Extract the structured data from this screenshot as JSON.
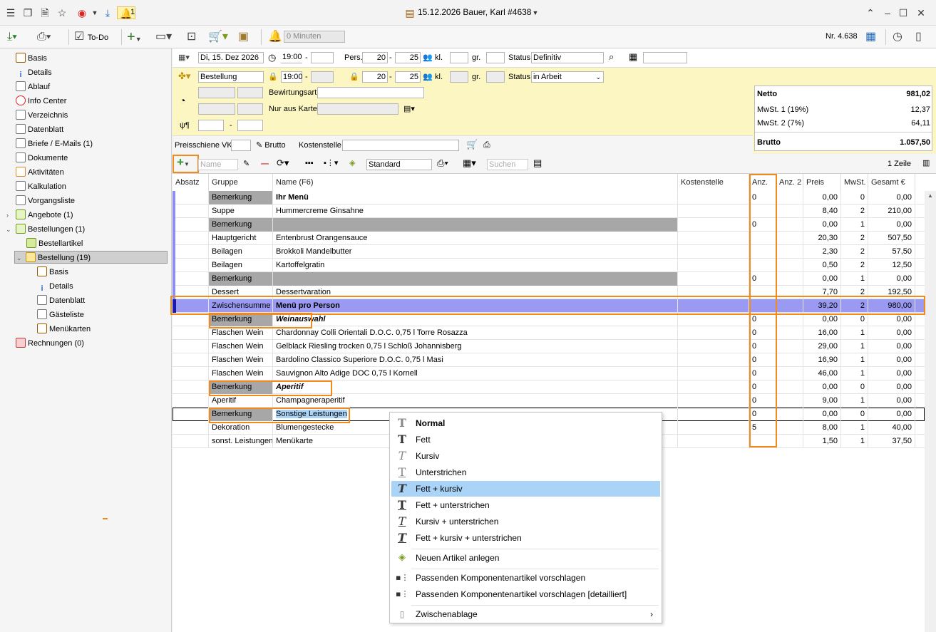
{
  "window": {
    "title": "15.12.2026 Bauer, Karl #4638",
    "notification_count": "1"
  },
  "toolbar": {
    "todo_label": "To-Do",
    "minutes_placeholder": "0 Minuten",
    "doc_number": "Nr. 4.638"
  },
  "sidebar": {
    "items": [
      {
        "label": "Basis"
      },
      {
        "label": "Details"
      },
      {
        "label": "Ablauf"
      },
      {
        "label": "Info Center"
      },
      {
        "label": "Verzeichnis"
      },
      {
        "label": "Datenblatt"
      },
      {
        "label": "Briefe / E-Mails (1)"
      },
      {
        "label": "Dokumente"
      },
      {
        "label": "Aktivitäten"
      },
      {
        "label": "Kalkulation"
      },
      {
        "label": "Vorgangsliste"
      },
      {
        "label": "Angebote (1)"
      },
      {
        "label": "Bestellungen (1)"
      },
      {
        "label": "Bestellartikel"
      },
      {
        "label": "Bestellung (19)"
      },
      {
        "label": "Basis"
      },
      {
        "label": "Details"
      },
      {
        "label": "Datenblatt"
      },
      {
        "label": "Gästeliste"
      },
      {
        "label": "Menükarten"
      },
      {
        "label": "Rechnungen (0)"
      }
    ]
  },
  "form": {
    "date": "Di, 15. Dez 2026",
    "time_from": "19:00",
    "pers_label": "Pers.",
    "pers_from": "20",
    "pers_to": "25",
    "kl_label": "kl.",
    "gr_label": "gr.",
    "status_label": "Status",
    "status_value": "Definitiv",
    "type_value": "Bestellung",
    "time2_from": "19:00",
    "pers2_from": "20",
    "pers2_to": "25",
    "status2_value": "in Arbeit",
    "bewirtung_label": "Bewirtungsart",
    "nur_aus_karte_label": "Nur aus Karte",
    "dash": "-",
    "preisschiene_label": "Preisschiene VK",
    "brutto_label": "Brutto",
    "kostenstelle_label": "Kostenstelle"
  },
  "totals": {
    "netto_label": "Netto",
    "netto_value": "981,02",
    "mwst1_label": "MwSt. 1 (19%)",
    "mwst1_value": "12,37",
    "mwst2_label": "MwSt. 2 (7%)",
    "mwst2_value": "64,11",
    "brutto_label": "Brutto",
    "brutto_value": "1.057,50"
  },
  "listbar": {
    "name_placeholder": "Name",
    "view_value": "Standard",
    "search_placeholder": "Suchen",
    "row_count": "1 Zeile"
  },
  "table": {
    "columns": [
      "Absatz",
      "Gruppe",
      "Name (F6)",
      "Kostenstelle",
      "Anz.",
      "Anz. 2",
      "Preis",
      "MwSt.",
      "Gesamt €"
    ],
    "rows": [
      {
        "gruppe": "Bemerkung",
        "name": "Ihr Menü",
        "anz": "0",
        "preis": "0,00",
        "mwst": "0",
        "gesamt": "0,00",
        "style": "bold",
        "gray": true,
        "bar": true
      },
      {
        "gruppe": "Suppe",
        "name": "Hummercreme Ginsahne",
        "anz": "",
        "preis": "8,40",
        "mwst": "2",
        "gesamt": "210,00",
        "style": "",
        "gray": false,
        "bar": true
      },
      {
        "gruppe": "Bemerkung",
        "name": "",
        "anz": "0",
        "preis": "0,00",
        "mwst": "1",
        "gesamt": "0,00",
        "style": "",
        "gray": true,
        "bar": true
      },
      {
        "gruppe": "Hauptgericht",
        "name": "Entenbrust Orangensauce",
        "anz": "",
        "preis": "20,30",
        "mwst": "2",
        "gesamt": "507,50",
        "style": "",
        "gray": false,
        "bar": true
      },
      {
        "gruppe": "Beilagen",
        "name": "Brokkoli Mandelbutter",
        "anz": "",
        "preis": "2,30",
        "mwst": "2",
        "gesamt": "57,50",
        "style": "",
        "gray": false,
        "bar": true
      },
      {
        "gruppe": "Beilagen",
        "name": "Kartoffelgratin",
        "anz": "",
        "preis": "0,50",
        "mwst": "2",
        "gesamt": "12,50",
        "style": "",
        "gray": false,
        "bar": true
      },
      {
        "gruppe": "Bemerkung",
        "name": "",
        "anz": "0",
        "preis": "0,00",
        "mwst": "1",
        "gesamt": "0,00",
        "style": "",
        "gray": true,
        "bar": true
      },
      {
        "gruppe": "Dessert",
        "name": "Dessertvaration",
        "anz": "",
        "preis": "7,70",
        "mwst": "2",
        "gesamt": "192,50",
        "style": "",
        "gray": false,
        "bar": true
      },
      {
        "gruppe": "Zwischensumme",
        "name": "Menü pro Person",
        "anz": "",
        "preis": "39,20",
        "mwst": "2",
        "gesamt": "980,00",
        "style": "bold",
        "gray": false,
        "bar": true,
        "sum": true
      },
      {
        "gruppe": "Bemerkung",
        "name": "Weinauswahl",
        "anz": "0",
        "preis": "0,00",
        "mwst": "0",
        "gesamt": "0,00",
        "style": "bolditalic",
        "gray": true,
        "bar": false
      },
      {
        "gruppe": "Flaschen Wein",
        "name": "Chardonnay Colli Orientali D.O.C. 0,75 l Torre Rosazza",
        "anz": "0",
        "preis": "16,00",
        "mwst": "1",
        "gesamt": "0,00",
        "style": "",
        "gray": false,
        "bar": false
      },
      {
        "gruppe": "Flaschen Wein",
        "name": "Gelblack Riesling trocken 0,75 l Schloß Johannisberg",
        "anz": "0",
        "preis": "29,00",
        "mwst": "1",
        "gesamt": "0,00",
        "style": "",
        "gray": false,
        "bar": false
      },
      {
        "gruppe": "Flaschen Wein",
        "name": "Bardolino Classico Superiore D.O.C. 0,75 l Masi",
        "anz": "0",
        "preis": "16,90",
        "mwst": "1",
        "gesamt": "0,00",
        "style": "",
        "gray": false,
        "bar": false
      },
      {
        "gruppe": "Flaschen Wein",
        "name": "Sauvignon Alto Adige DOC 0,75 l Kornell",
        "anz": "0",
        "preis": "46,00",
        "mwst": "1",
        "gesamt": "0,00",
        "style": "",
        "gray": false,
        "bar": false
      },
      {
        "gruppe": "Bemerkung",
        "name": "Aperitif",
        "anz": "0",
        "preis": "0,00",
        "mwst": "0",
        "gesamt": "0,00",
        "style": "bolditalic",
        "gray": true,
        "bar": false
      },
      {
        "gruppe": "Aperitif",
        "name": "Champagneraperitif",
        "anz": "0",
        "preis": "9,00",
        "mwst": "1",
        "gesamt": "0,00",
        "style": "",
        "gray": false,
        "bar": false
      },
      {
        "gruppe": "Bemerkung",
        "name": "Sonstige Leistungen",
        "anz": "0",
        "preis": "0,00",
        "mwst": "0",
        "gesamt": "0,00",
        "style": "selected",
        "gray": true,
        "bar": false,
        "current": true
      },
      {
        "gruppe": "Dekoration",
        "name": "Blumengestecke",
        "anz": "5",
        "preis": "8,00",
        "mwst": "1",
        "gesamt": "40,00",
        "style": "",
        "gray": false,
        "bar": false
      },
      {
        "gruppe": "sonst. Leistungen",
        "name": "Menükarte",
        "anz": "",
        "preis": "1,50",
        "mwst": "1",
        "gesamt": "37,50",
        "style": "",
        "gray": false,
        "bar": false
      }
    ]
  },
  "context_menu": {
    "items": [
      {
        "label": "Normal",
        "style": "bold"
      },
      {
        "label": "Fett",
        "style": ""
      },
      {
        "label": "Kursiv",
        "style": ""
      },
      {
        "label": "Unterstrichen",
        "style": ""
      },
      {
        "label": "Fett + kursiv",
        "style": "",
        "highlighted": true
      },
      {
        "label": "Fett + unterstrichen",
        "style": ""
      },
      {
        "label": "Kursiv + unterstrichen",
        "style": ""
      },
      {
        "label": "Fett + kursiv + unterstrichen",
        "style": ""
      },
      {
        "label": "Neuen Artikel anlegen",
        "style": ""
      },
      {
        "label": "Passenden Komponentenartikel vorschlagen",
        "style": ""
      },
      {
        "label": "Passenden Komponentenartikel vorschlagen [detailliert]",
        "style": ""
      },
      {
        "label": "Zwischenablage",
        "style": ""
      }
    ]
  },
  "colors": {
    "accent_orange": "#f08a1c",
    "form_yellow": "#fbf6c2",
    "row_bar_blue": "#8c8cf2",
    "menu_highlight": "#a9d3f7"
  }
}
